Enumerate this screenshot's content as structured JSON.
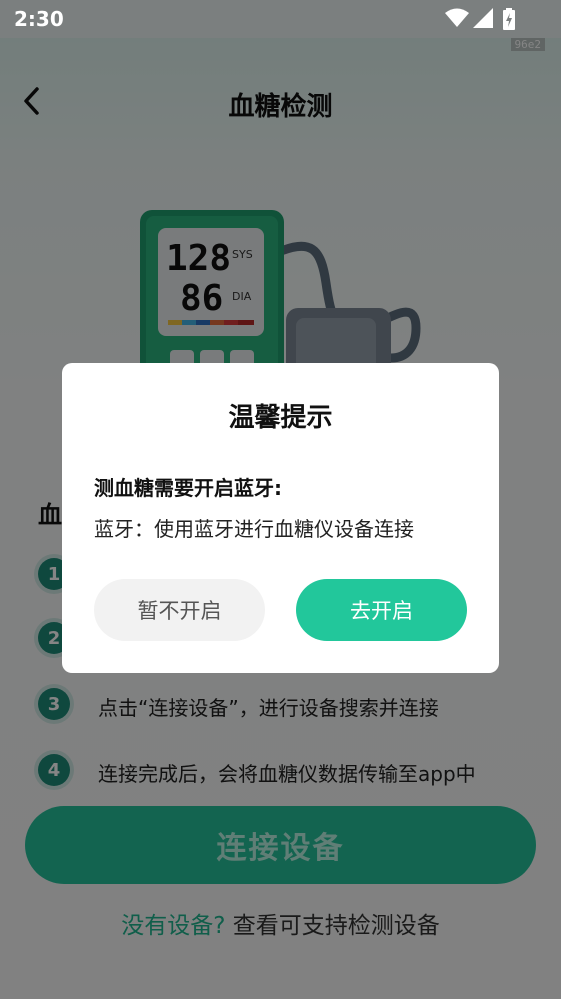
{
  "status_bar": {
    "time": "2:30"
  },
  "nav": {
    "title": "血糖检测",
    "version_badge": "96e2"
  },
  "device": {
    "sys_value": "128",
    "sys_label": "SYS",
    "dia_value": "86",
    "dia_label": "DIA"
  },
  "instructions": {
    "title": "血",
    "steps": [
      {
        "num": "1",
        "text": ""
      },
      {
        "num": "2",
        "text": ""
      },
      {
        "num": "3",
        "text": "点击“连接设备”，进行设备搜索并连接"
      },
      {
        "num": "4",
        "text": "连接完成后，会将血糖仪数据传输至app中"
      }
    ]
  },
  "connect_button": {
    "label": "连接设备"
  },
  "support": {
    "link": "没有设备?",
    "text": " 查看可支持检测设备"
  },
  "dialog": {
    "title": "温馨提示",
    "heading": "测血糖需要开启蓝牙:",
    "body": "蓝牙：使用蓝牙进行血糖仪设备连接",
    "cancel_label": "暂不开启",
    "confirm_label": "去开启"
  },
  "colors": {
    "accent": "#22c79b",
    "step_circle": "#1e8a78",
    "scrim": "rgba(0,0,0,0.48)"
  },
  "icons": [
    "back-icon",
    "wifi-icon",
    "signal-icon",
    "battery-icon"
  ]
}
